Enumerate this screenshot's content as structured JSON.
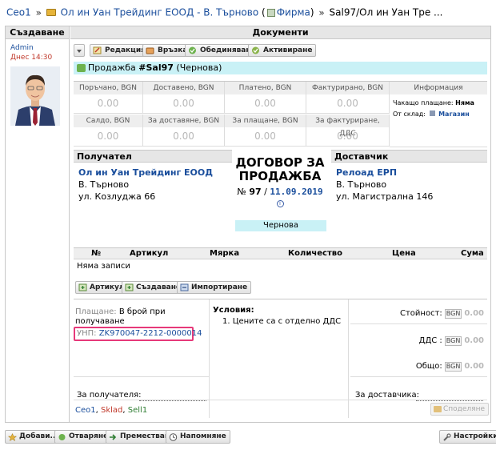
{
  "breadcrumb": {
    "root": "Ceo1",
    "sep": "»",
    "company": "Ол ин Уан Трейдинг ЕООД - В. Търново",
    "company_type_open": "(",
    "company_type": "Фирма",
    "company_type_close": ")",
    "document": "Sal97/Ол ин Уан Тре ..."
  },
  "left": {
    "header": "Създаване",
    "user": "Admin",
    "time": "Днес 14:30"
  },
  "right": {
    "header": "Документи"
  },
  "toolbar": {
    "edit": "Редакция",
    "link": "Връзка",
    "merge": "Обединяване",
    "activate": "Активиране"
  },
  "title": {
    "prefix": "Продажба",
    "id": "#Sal97",
    "status": "(Чернова)"
  },
  "totals": {
    "row1": [
      {
        "label": "Поръчано, BGN",
        "value": "0.00"
      },
      {
        "label": "Доставено, BGN",
        "value": "0.00"
      },
      {
        "label": "Платено, BGN",
        "value": "0.00"
      },
      {
        "label": "Фактурирано, BGN",
        "value": "0.00"
      }
    ],
    "row2": [
      {
        "label": "Салдо, BGN",
        "value": "0.00"
      },
      {
        "label": "За доставяне, BGN",
        "value": "0.00"
      },
      {
        "label": "За плащане, BGN",
        "value": "0.00"
      },
      {
        "label": "За фактуриране, ДДС",
        "value": "0.00"
      }
    ],
    "info_header": "Информация",
    "waiting_label": "Чакащо плащане:",
    "waiting_value": "Няма",
    "warehouse_label": "От склад:",
    "warehouse_value": "Магазин"
  },
  "recipient": {
    "header": "Получател",
    "name": "Ол ин Уан Трейдинг ЕООД",
    "city": "В. Търново",
    "address": "ул. Козлуджа 66"
  },
  "contract": {
    "title_line1": "ДОГОВОР ЗА",
    "title_line2": "ПРОДАЖБА",
    "num_prefix": "№",
    "number": "97",
    "slash": "/",
    "date": "11.09.2019",
    "info_glyph": "i",
    "status": "Чернова"
  },
  "supplier": {
    "header": "Доставчик",
    "name": "Релоад ЕРП",
    "city": "В. Търново",
    "address": "ул. Магистрална 146"
  },
  "items": {
    "columns": [
      "№",
      "Артикул",
      "Мярка",
      "Количество",
      "Цена",
      "Сума"
    ],
    "empty": "Няма записи"
  },
  "item_buttons": {
    "article": "Артикул",
    "create": "Създаване",
    "import": "Импортиране"
  },
  "payment": {
    "label": "Плащане:",
    "value": "В брой при получаване",
    "unp_label": "УНП:",
    "unp_value": "ZK970047-2212-0000014",
    "for_recipient": "За получателя:"
  },
  "conditions": {
    "title": "Условия:",
    "items": [
      "1. Цените са с отделно ДДС"
    ]
  },
  "summary": {
    "value_label": "Стойност:",
    "vat_label": "ДДС :",
    "total_label": "Общо:",
    "currency": "BGN",
    "value": "0.00",
    "vat": "0.00",
    "total": "0.00",
    "for_supplier": "За доставчика:"
  },
  "signature": {
    "a": "Ceo1",
    "b": "Sklad",
    "c": "Sell1",
    "sep": ","
  },
  "share": "Споделяне",
  "footer": {
    "add": "Добави...",
    "open": "Отваряне",
    "move": "Преместване",
    "remind": "Напомняне",
    "settings": "Настройки"
  }
}
